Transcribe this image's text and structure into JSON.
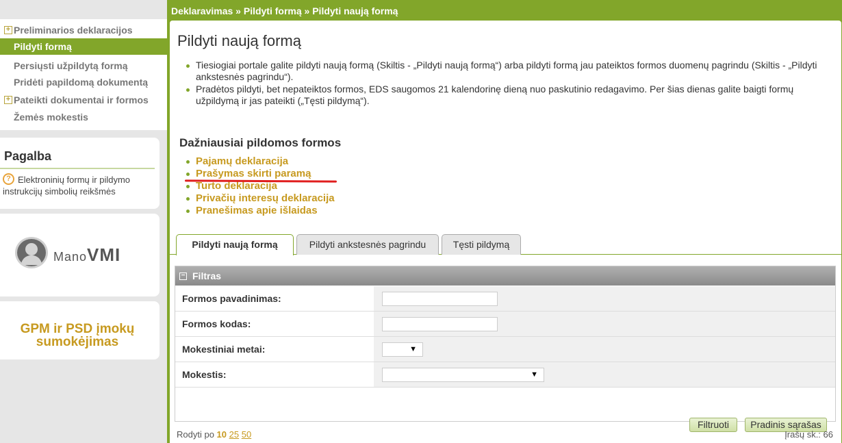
{
  "sidebar": {
    "menu": [
      {
        "label": "Preliminarios deklaracijos",
        "expandable": true
      },
      {
        "label": "Pildyti formą",
        "active": true
      },
      {
        "label": "Persiųsti užpildytą formą"
      },
      {
        "label": "Pridėti papildomą dokumentą"
      },
      {
        "label": "Pateikti dokumentai ir formos",
        "expandable": true
      },
      {
        "label": "Žemės mokestis"
      }
    ],
    "help": {
      "title": "Pagalba",
      "icon": "?",
      "text": "Elektroninių formų ir pildymo instrukcijų simbolių reikšmės"
    },
    "manovmi": {
      "small": "Mano",
      "big": "VMI"
    },
    "gpm": {
      "line1": "GPM ir PSD įmokų",
      "line2": "sumokėjimas"
    }
  },
  "breadcrumb": "Deklaravimas » Pildyti formą » Pildyti naują formą",
  "page_title": "Pildyti naują formą",
  "info": [
    "Tiesiogiai portale galite pildyti naują formą (Skiltis - „Pildyti naują formą“) arba pildyti formą jau pateiktos formos duomenų pagrindu (Skiltis - „Pildyti ankstesnės pagrindu“).",
    "Pradėtos pildyti, bet nepateiktos formos, EDS saugomos 21 kalendorinę dieną nuo paskutinio redagavimo. Per šias dienas galite baigti formų užpildymą ir jas pateikti („Tęsti pildymą“)."
  ],
  "frequent": {
    "title": "Dažniausiai pildomos formos",
    "items": [
      "Pajamų deklaracija",
      "Prašymas skirti paramą",
      "Turto deklaracija",
      "Privačių interesų deklaracija",
      "Pranešimas apie išlaidas"
    ]
  },
  "tabs": [
    "Pildyti naują formą",
    "Pildyti ankstesnės pagrindu",
    "Tęsti pildymą"
  ],
  "filter": {
    "title": "Filtras",
    "collapse_icon": "⊟",
    "fields": [
      {
        "label": "Formos pavadinimas:",
        "value": ""
      },
      {
        "label": "Formos kodas:",
        "value": ""
      },
      {
        "label": "Mokestiniai metai:",
        "value": ""
      },
      {
        "label": "Mokestis:",
        "value": ""
      }
    ],
    "btn_filter": "Filtruoti",
    "btn_reset": "Pradinis sąrašas"
  },
  "pager": {
    "prefix": "Rodyti po",
    "options": [
      "10",
      "25",
      "50"
    ],
    "count_text": "Įrašų sk.: 66"
  },
  "colors": {
    "green": "#82a62a",
    "gold": "#c79a20",
    "red_underline": "#e01e1e"
  }
}
